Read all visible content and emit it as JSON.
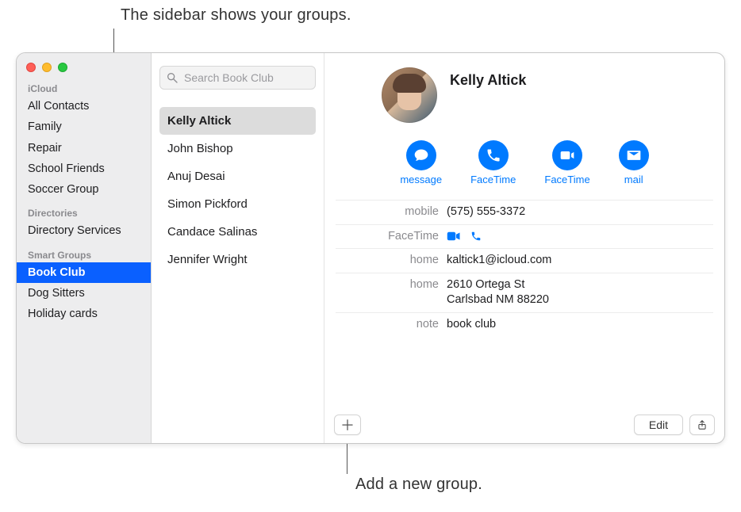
{
  "callouts": {
    "top": "The sidebar shows your groups.",
    "bottom": "Add a new group."
  },
  "sidebar": {
    "sections": [
      {
        "header": "iCloud",
        "items": [
          "All Contacts",
          "Family",
          "Repair",
          "School Friends",
          "Soccer Group"
        ]
      },
      {
        "header": "Directories",
        "items": [
          "Directory Services"
        ]
      },
      {
        "header": "Smart Groups",
        "items": [
          "Book Club",
          "Dog Sitters",
          "Holiday cards"
        ],
        "selected": 0
      }
    ]
  },
  "search": {
    "placeholder": "Search Book Club"
  },
  "contactList": {
    "items": [
      "Kelly Altick",
      "John Bishop",
      "Anuj Desai",
      "Simon Pickford",
      "Candace Salinas",
      "Jennifer Wright"
    ],
    "selectedIndex": 0
  },
  "card": {
    "name": "Kelly Altick",
    "actions": {
      "message": "message",
      "facetimeAudio": "FaceTime",
      "facetimeVideo": "FaceTime",
      "mail": "mail"
    },
    "fields": {
      "mobile_label": "mobile",
      "mobile_value": "(575) 555-3372",
      "facetime_label": "FaceTime",
      "homeEmail_label": "home",
      "homeEmail_value": "kaltick1@icloud.com",
      "homeAddr_label": "home",
      "homeAddr_line1": "2610 Ortega St",
      "homeAddr_line2": "Carlsbad NM 88220",
      "note_label": "note",
      "note_value": "book club"
    }
  },
  "buttons": {
    "edit": "Edit"
  }
}
